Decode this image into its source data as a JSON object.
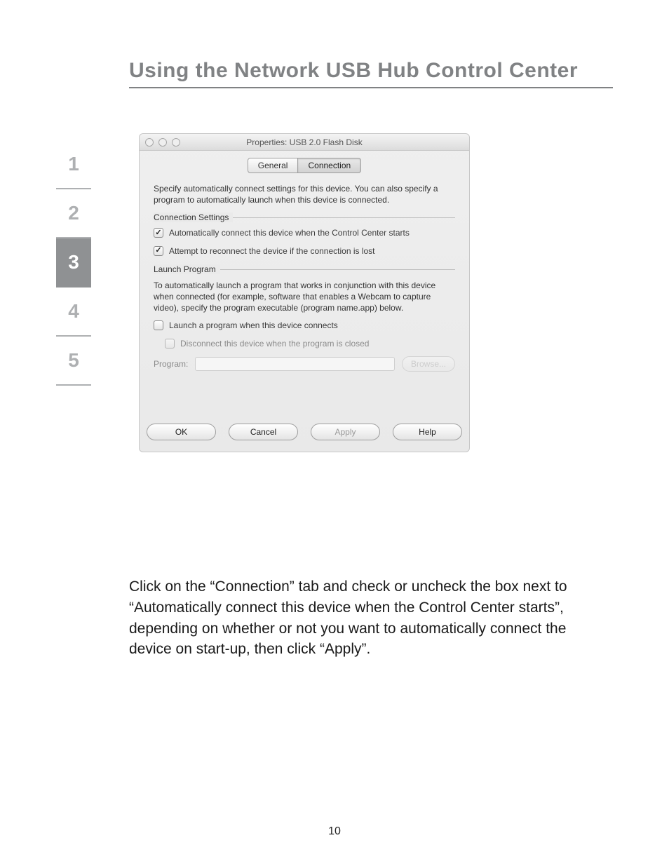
{
  "page": {
    "title": "Using the Network USB Hub Control Center",
    "number": "10"
  },
  "nav": {
    "items": [
      "1",
      "2",
      "3",
      "4",
      "5"
    ],
    "activeIndex": 2
  },
  "dialog": {
    "title": "Properties: USB 2.0 Flash Disk",
    "tabs": {
      "general": "General",
      "connection": "Connection"
    },
    "intro": "Specify automatically connect settings for this device. You can also specify a program to automatically launch when this device is connected.",
    "connSettingsLabel": "Connection Settings",
    "autoConnect": "Automatically connect this device when the Control Center starts",
    "reconnect": "Attempt to reconnect the device if the connection is lost",
    "launchLabel": "Launch Program",
    "launchIntro": "To automatically launch a program that works in conjunction with this device when connected (for example, software that enables a Webcam to capture video), specify the program executable (program name.app) below.",
    "launchWhenConn": "Launch a program when this device connects",
    "disconnectOnClose": "Disconnect this device when the program is closed",
    "programLabel": "Program:",
    "programValue": "",
    "browse": "Browse...",
    "buttons": {
      "ok": "OK",
      "cancel": "Cancel",
      "apply": "Apply",
      "help": "Help"
    }
  },
  "caption": "Click on the “Connection” tab and check or uncheck the box next to “Automatically connect this device when the Control Center starts”, depending on whether or not you want to automatically connect the device on start-up, then click “Apply”."
}
